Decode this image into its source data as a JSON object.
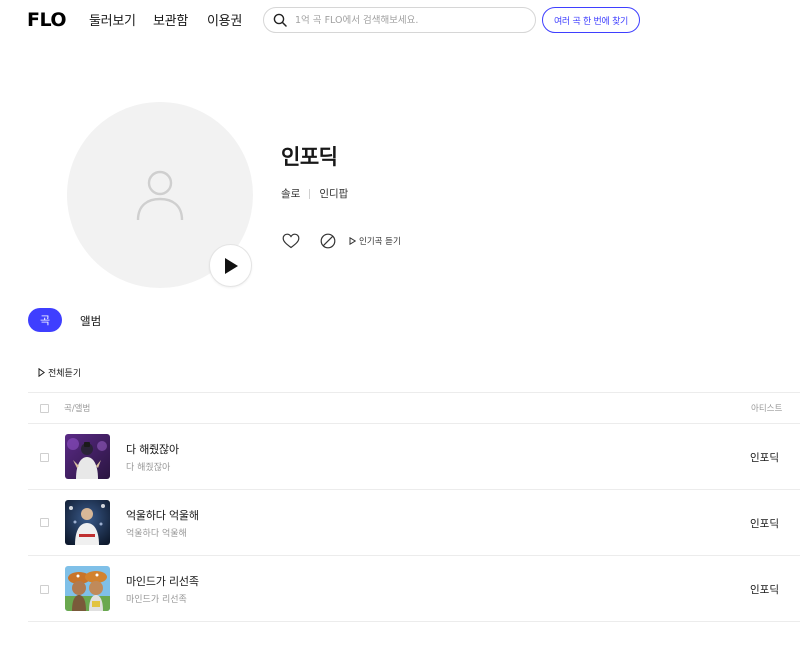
{
  "header": {
    "logo": "FLO",
    "nav": [
      "둘러보기",
      "보관함",
      "이용권"
    ],
    "search": {
      "placeholder": "1억 곡 FLO에서 검색해보세요.",
      "value": ""
    },
    "find_button": "여러 곡 한 번에 찾기"
  },
  "artist": {
    "name": "인포딕",
    "type": "솔로",
    "genre": "인디팝",
    "popular_play_label": "인기곡 듣기"
  },
  "tabs": [
    {
      "label": "곡",
      "active": true
    },
    {
      "label": "앨범",
      "active": false
    }
  ],
  "tracklist": {
    "play_all_label": "전체듣기",
    "columns": {
      "song_album": "곡/앨범",
      "artist": "아티스트"
    },
    "tracks": [
      {
        "title": "다 해줬잖아",
        "album": "다 해줬잖아",
        "artist": "인포딕"
      },
      {
        "title": "억울하다 억울해",
        "album": "억울하다 억울해",
        "artist": "인포딕"
      },
      {
        "title": "마인드가 리선족",
        "album": "마인드가 리선족",
        "artist": "인포딕"
      }
    ]
  },
  "colors": {
    "accent": "#3f3fff",
    "avatar_bg": "#f2f2f2",
    "muted_text": "#989898"
  },
  "icons": [
    "search-icon",
    "person-icon",
    "play-icon",
    "heart-icon",
    "block-icon",
    "play-triangle-icon"
  ]
}
